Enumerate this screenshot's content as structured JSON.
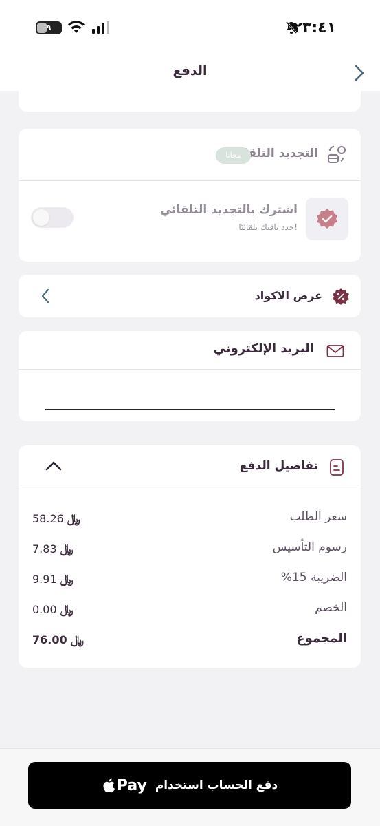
{
  "status_bar": {
    "time": "٢٣:٤١",
    "battery": "٩"
  },
  "nav": {
    "title": "الدفع"
  },
  "auto_renew": {
    "title": "التجديد التلقائي",
    "badge": "مجانا",
    "subscribe_title": "اشترك بالتجديد التلقائي",
    "subscribe_desc": "جدد باقتك تلقائيًا!"
  },
  "codes": {
    "label": "عرض الاكواد"
  },
  "email": {
    "title": "البريد الإلكتروني",
    "value": "",
    "placeholder": ""
  },
  "payment_details": {
    "title": "تفاصيل الدفع",
    "currency_symbol": "﷼",
    "rows": [
      {
        "label": "سعر الطلب",
        "value": "58.26"
      },
      {
        "label": "رسوم التأسيس",
        "value": "7.83"
      },
      {
        "label": "الضريبة 15%",
        "value": "9.91"
      },
      {
        "label": "الخصم",
        "value": "0.00"
      },
      {
        "label": "المجموع",
        "value": "76.00"
      }
    ]
  },
  "checkout": {
    "label": "دفع الحساب استخدام",
    "brand": "Pay"
  },
  "colors": {
    "accent": "#7a3346",
    "text": "#3a2a3c",
    "badge": "#d7e3dc"
  }
}
